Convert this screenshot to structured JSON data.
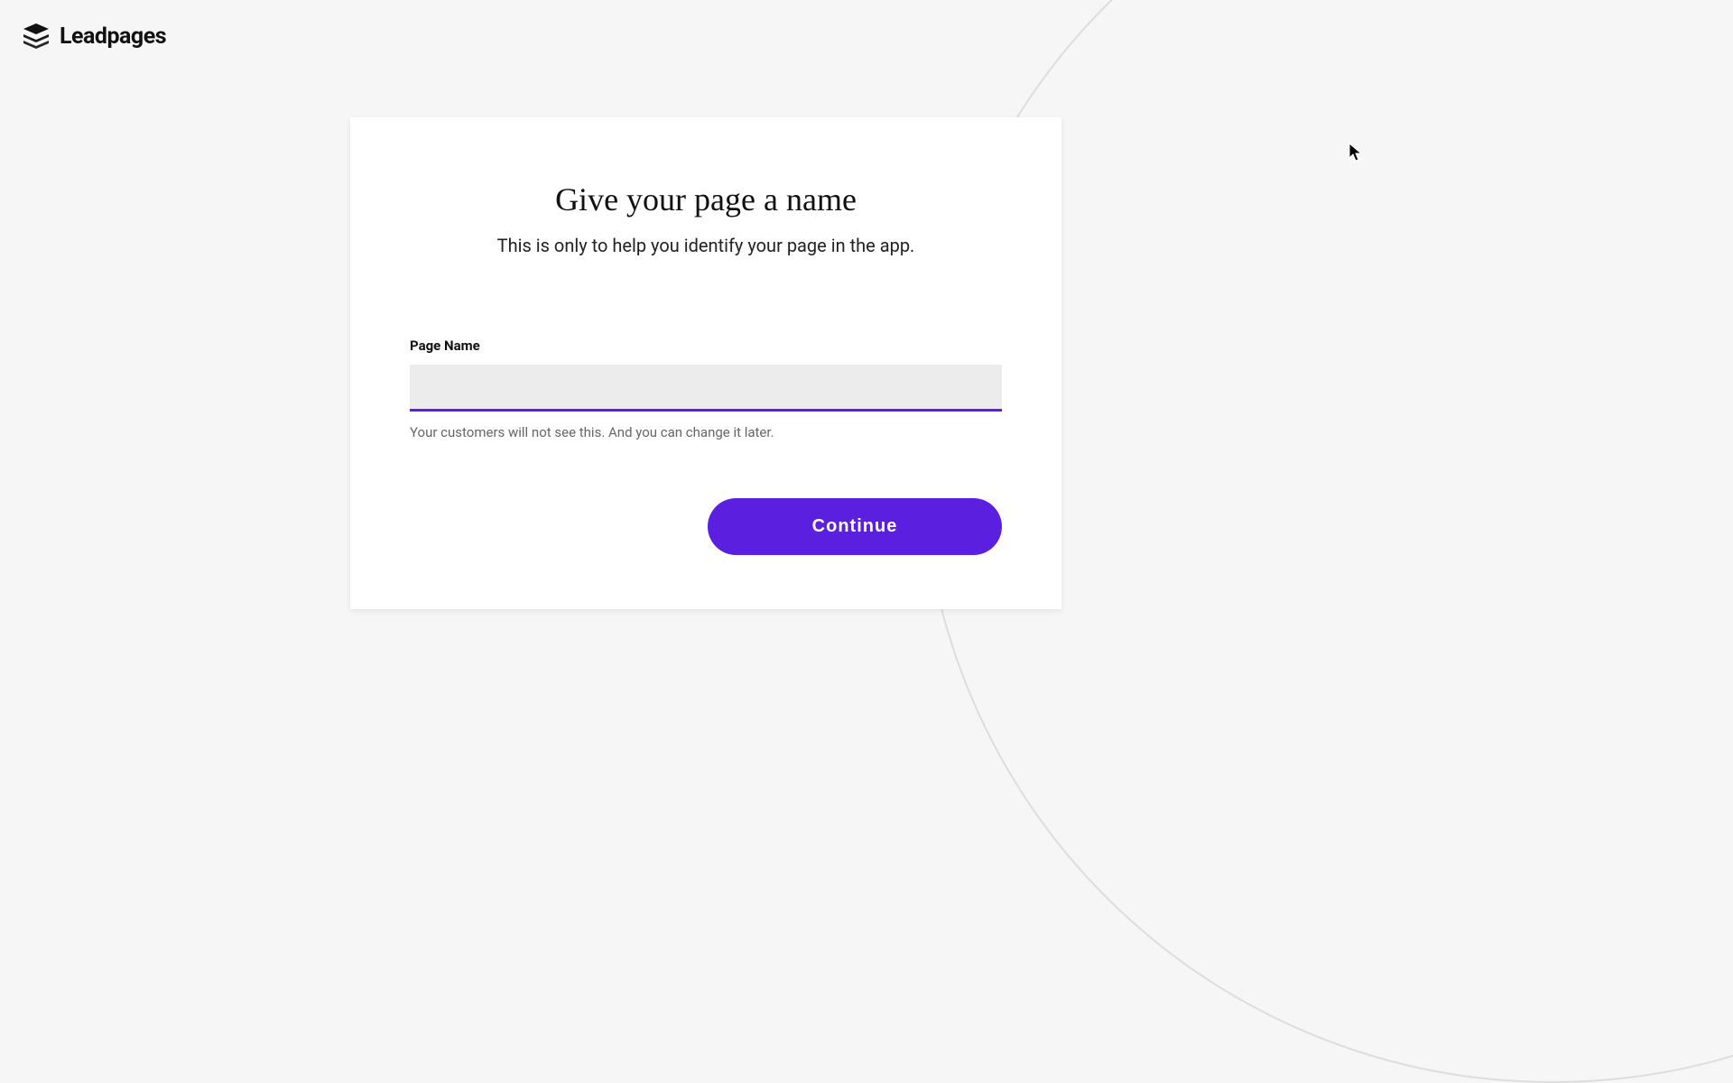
{
  "brand": {
    "name": "Leadpages"
  },
  "card": {
    "title": "Give your page a name",
    "subtitle": "This is only to help you identify your page in the app.",
    "field_label": "Page Name",
    "input_value": "",
    "helper_text": "Your customers will not see this. And you can change it later.",
    "continue_label": "Continue"
  }
}
